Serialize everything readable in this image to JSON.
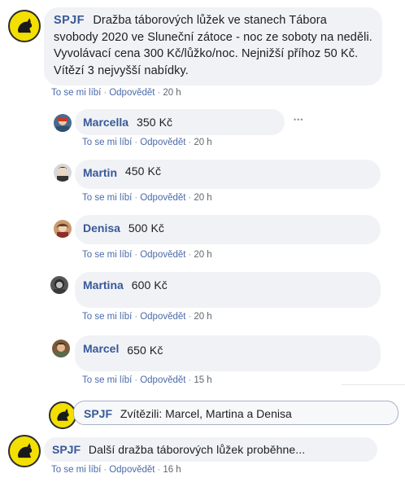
{
  "main_post": {
    "author": "SPJF",
    "text": "Dražba táborových lůžek ve stanech Tábora svobody 2020 ve Sluneční zátoce - noc ze soboty na neděli. Vyvolávací cena 300 Kč/lůžko/noc. Nejnižší příhoz 50 Kč. Vítězí 3 nejvyšší nabídky.",
    "like": "To se mi líbí",
    "reply": "Odpovědět",
    "time": "20 h"
  },
  "replies": [
    {
      "author": "Marcella",
      "text": "350 Kč",
      "like": "To se mi líbí",
      "reply": "Odpovědět",
      "time": "20 h",
      "more": "•••"
    },
    {
      "author": "Martin",
      "text": "450 Kč",
      "like": "To se mi líbí",
      "reply": "Odpovědět",
      "time": "20 h"
    },
    {
      "author": "Denisa",
      "text": "500 Kč",
      "like": "To se mi líbí",
      "reply": "Odpovědět",
      "time": "20 h"
    },
    {
      "author": "Martina",
      "text": "600 Kč",
      "like": "To se mi líbí",
      "reply": "Odpovědět",
      "time": "20 h"
    },
    {
      "author": "Marcel",
      "text": "650 Kč",
      "like": "To se mi líbí",
      "reply": "Odpovědět",
      "time": "15 h"
    }
  ],
  "winner_reply": {
    "author": "SPJF",
    "text": "Zvítězili: Marcel, Martina a Denisa"
  },
  "next_post": {
    "author": "SPJF",
    "text": "Další dražba táborových lůžek proběhne...",
    "like": "To se mi líbí",
    "reply": "Odpovědět",
    "time": "16 h"
  },
  "colors": {
    "author": "#385898",
    "bubble": "#f0f2f5",
    "logo": "#f4e000"
  }
}
